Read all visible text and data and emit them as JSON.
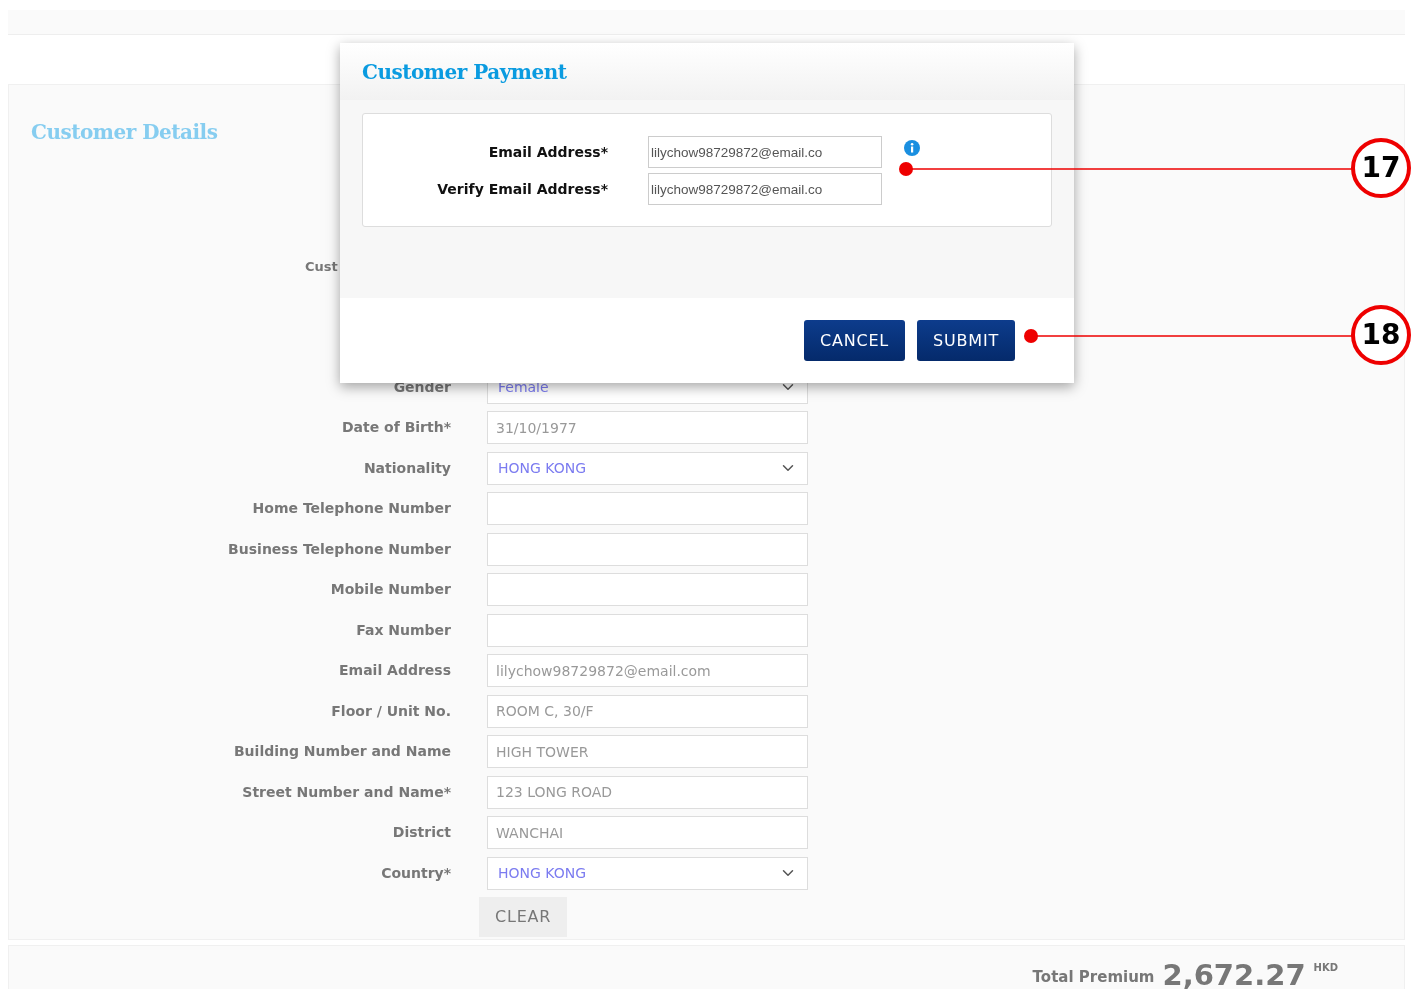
{
  "section": {
    "title": "Customer Details"
  },
  "fields": [
    {
      "label": "Cust",
      "kind": "cut"
    },
    {
      "label": "Gender",
      "kind": "select",
      "value": "Female"
    },
    {
      "label": "Date of Birth*",
      "kind": "text",
      "value": "31/10/1977"
    },
    {
      "label": "Nationality",
      "kind": "select",
      "value": "HONG KONG"
    },
    {
      "label": "Home Telephone Number",
      "kind": "text"
    },
    {
      "label": "Business Telephone Number",
      "kind": "text"
    },
    {
      "label": "Mobile Number",
      "kind": "text"
    },
    {
      "label": "Fax Number",
      "kind": "text"
    },
    {
      "label": "Email Address",
      "kind": "text",
      "value": "lilychow98729872@email.com"
    },
    {
      "label": "Floor / Unit No.",
      "kind": "text",
      "value": "ROOM C, 30/F"
    },
    {
      "label": "Building Number and Name",
      "kind": "text",
      "value": "HIGH TOWER"
    },
    {
      "label": "Street Number and Name*",
      "kind": "text",
      "value": "123 LONG ROAD"
    },
    {
      "label": "District",
      "kind": "text",
      "value": "WANCHAI"
    },
    {
      "label": "Country*",
      "kind": "select",
      "value": "HONG KONG"
    }
  ],
  "clear_button": "CLEAR",
  "total": {
    "label": "Total Premium",
    "amount": "2,672.27",
    "currency": "HKD"
  },
  "dialog": {
    "title": "Customer Payment",
    "fields": [
      {
        "label": "Email Address*",
        "value": "lilychow98729872@email.co",
        "info": true
      },
      {
        "label": "Verify Email Address*",
        "value": "lilychow98729872@email.co",
        "info": false
      }
    ],
    "buttons": [
      "CANCEL",
      "SUBMIT"
    ]
  },
  "callouts": [
    {
      "label": "17"
    },
    {
      "label": "18"
    }
  ]
}
